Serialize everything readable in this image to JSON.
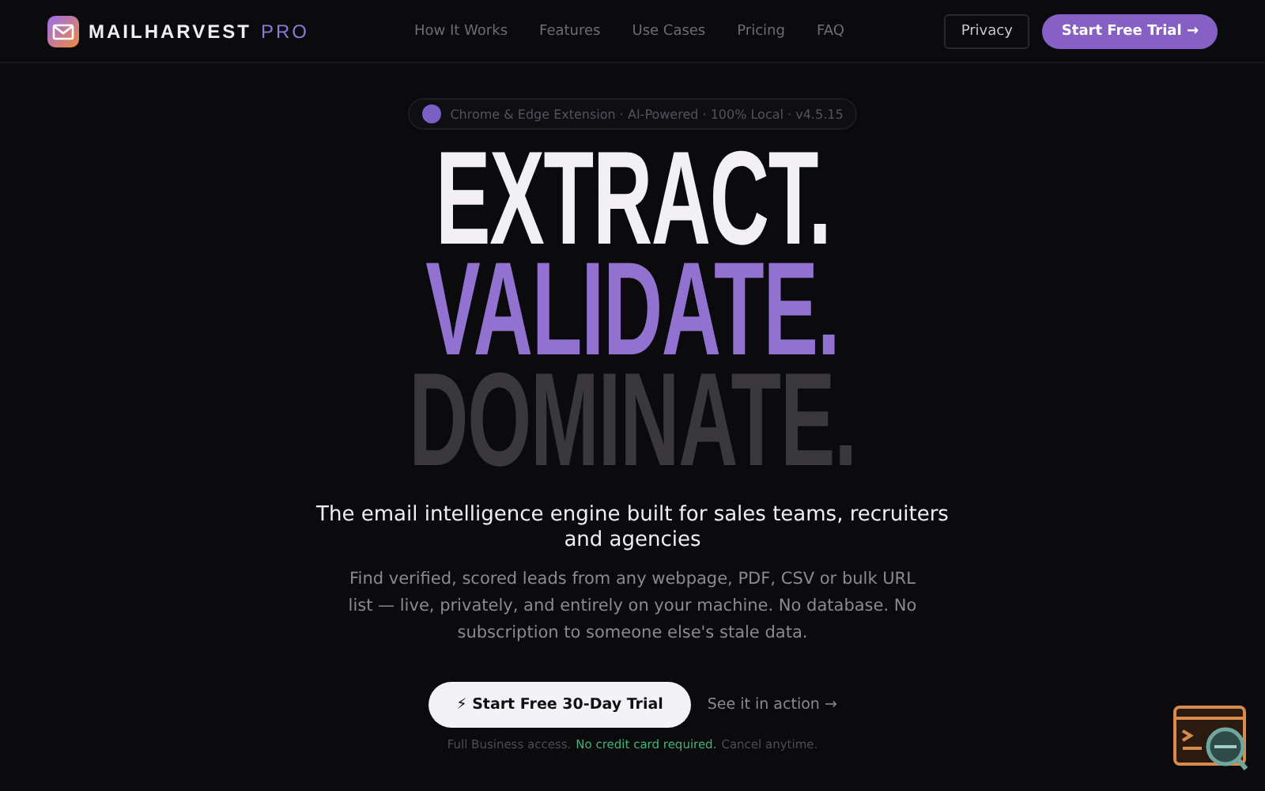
{
  "nav": {
    "brand": "MAILHARVEST",
    "brand_suffix": "PRO",
    "links": [
      {
        "label": "How It Works"
      },
      {
        "label": "Features"
      },
      {
        "label": "Use Cases"
      },
      {
        "label": "Pricing"
      },
      {
        "label": "FAQ"
      }
    ],
    "privacy": "Privacy",
    "cta": "Start Free Trial →"
  },
  "hero": {
    "badge": "Chrome & Edge Extension · AI-Powered · 100% Local · v4.5.15",
    "headline": [
      {
        "text": "EXTRACT.",
        "kind": "white"
      },
      {
        "text": "VALIDATE.",
        "kind": "accent"
      },
      {
        "text": "DOMINATE.",
        "kind": "muted"
      }
    ],
    "subtitle": "The email intelligence engine built for sales teams, recruiters and agencies",
    "description": "Find verified, scored leads from any webpage, PDF, CSV or bulk URL list — live, privately, and entirely on your machine. No database. No subscription to someone else's stale data.",
    "primary_button": "⚡ Start Free 30-Day Trial",
    "secondary_link": "See it in action →",
    "note": {
      "before": "Full Business access.",
      "highlight": "No credit card required.",
      "after": "Cancel anytime."
    }
  }
}
